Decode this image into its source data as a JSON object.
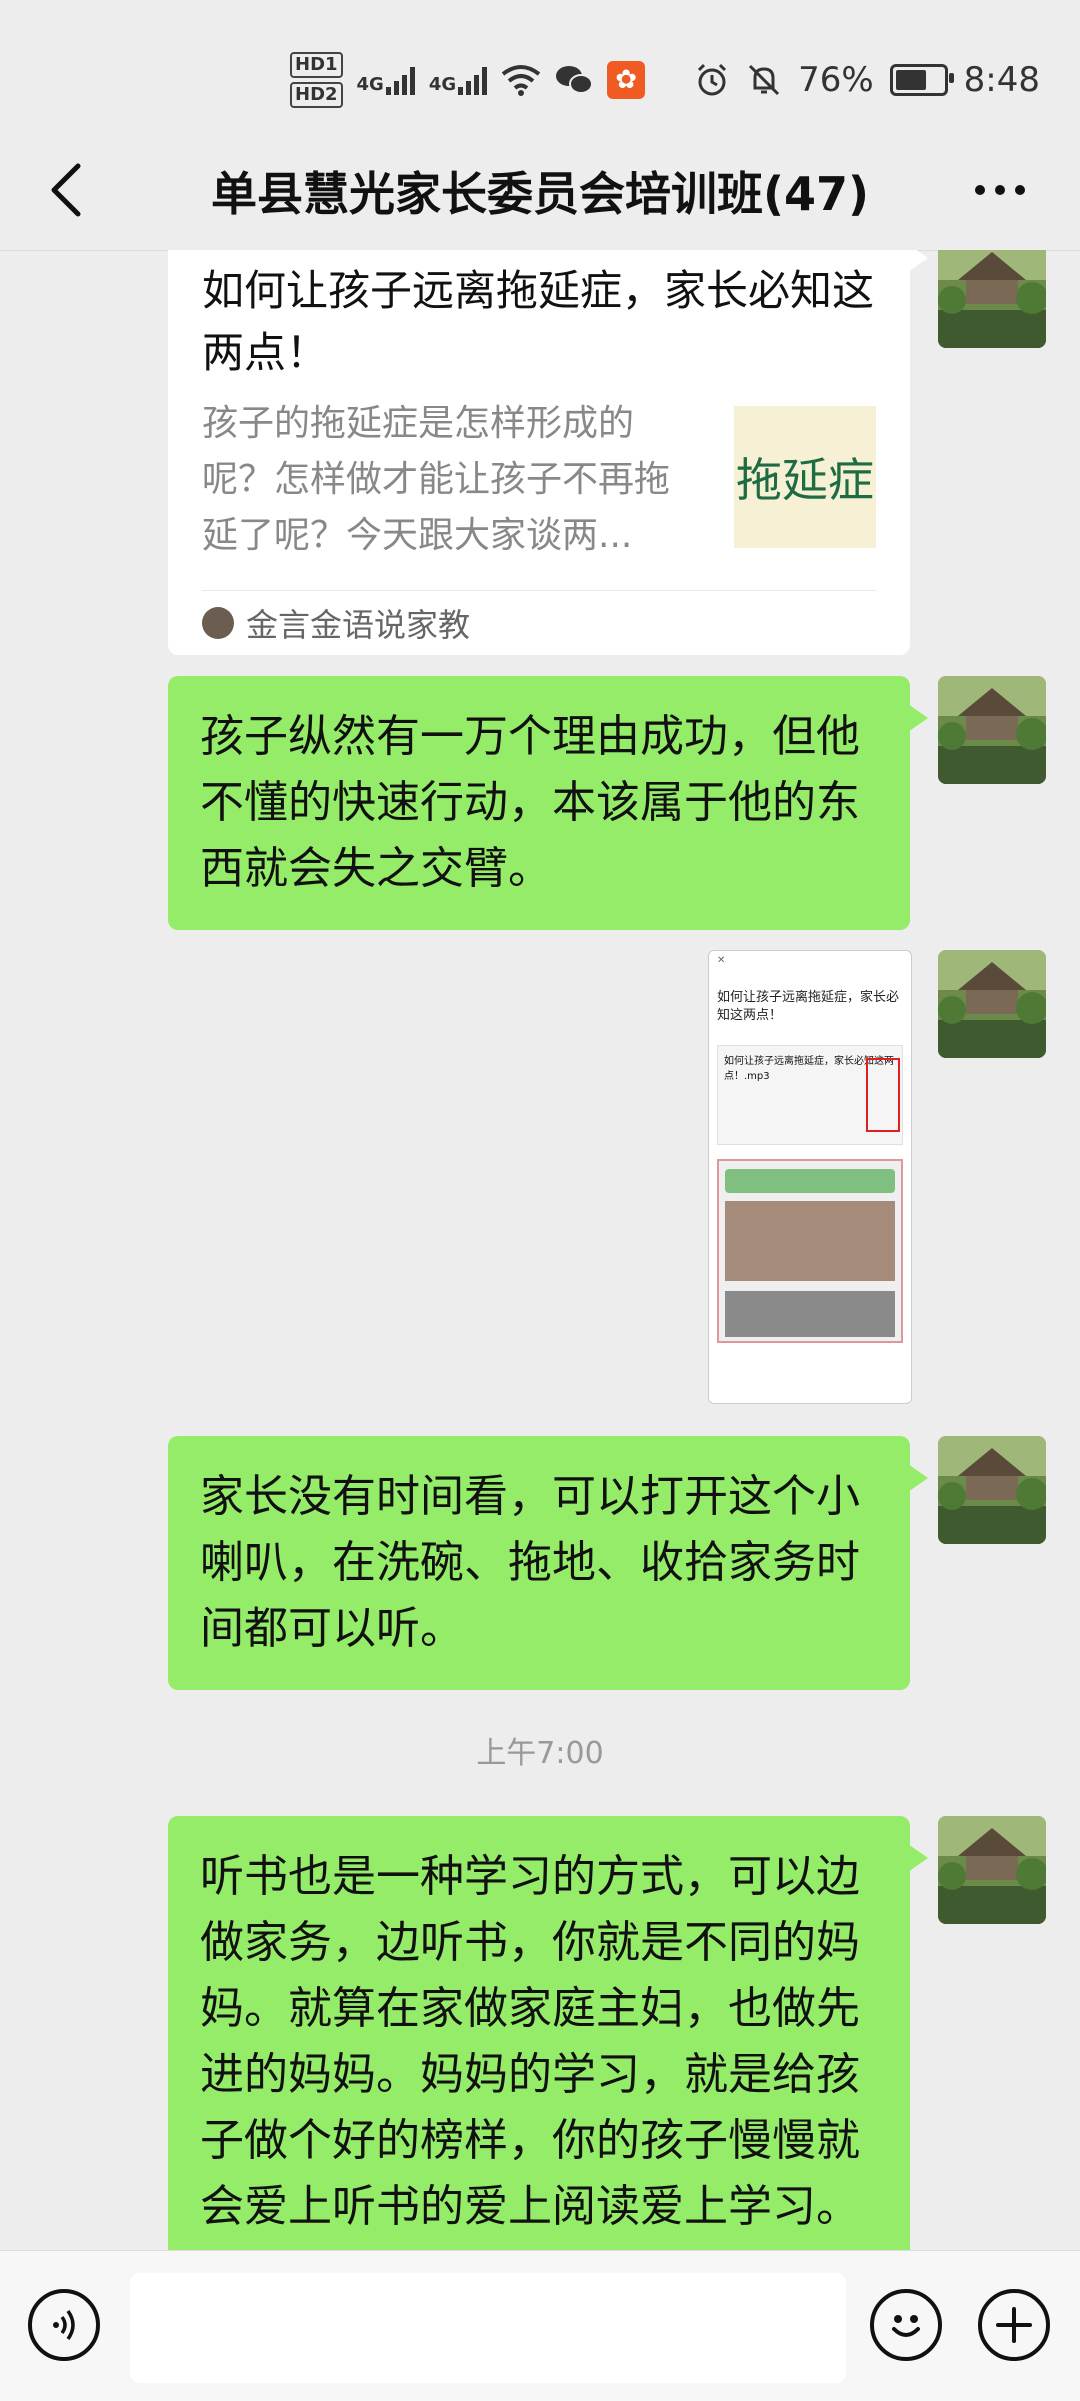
{
  "status_bar": {
    "hd1": "HD1",
    "hd2": "HD2",
    "net1": "4G",
    "net2": "4G",
    "battery_percent": "76%",
    "battery_level": 0.76,
    "time": "8:48",
    "icons": [
      "wifi-icon",
      "wechat-icon",
      "kuaishou-icon",
      "alarm-icon",
      "mute-icon",
      "battery-icon"
    ]
  },
  "header": {
    "title": "单县慧光家长委员会培训班(47)",
    "back_icon": "chevron-left-icon",
    "more_icon": "more-dots-icon"
  },
  "messages": [
    {
      "type": "link_card",
      "title": "如何让孩子远离拖延症，家长必知这两点！",
      "description": "孩子的拖延症是怎样形成的呢？怎样做才能让孩子不再拖延了呢？今天跟大家谈两...",
      "thumb_text": "拖延症",
      "source": "金言金语说家教"
    },
    {
      "type": "text",
      "text": "孩子纵然有一万个理由成功，但他不懂的快速行动，本该属于他的东西就会失之交臂。"
    },
    {
      "type": "image",
      "image_title": "如何让孩子远离拖延症，家长必知这两点！",
      "image_audio": "如何让孩子远离拖延症，家长必知这两点！.mp3"
    },
    {
      "type": "text",
      "text": "家长没有时间看，可以打开这个小喇叭，在洗碗、拖地、收拾家务时间都可以听。"
    },
    {
      "type": "timestamp",
      "text": "上午7:00"
    },
    {
      "type": "text",
      "text": "听书也是一种学习的方式，可以边做家务，边听书，你就是不同的妈妈。就算在家做家庭主妇，也做先进的妈妈。妈妈的学习，就是给孩子做个好的榜样，你的孩子慢慢就会爱上听书的爱上阅读爱上学习。"
    }
  ],
  "input_bar": {
    "voice_icon": "voice-icon",
    "emoji_icon": "emoji-icon",
    "plus_icon": "plus-icon",
    "value": ""
  },
  "colors": {
    "bubble_green": "#95ec69",
    "background": "#ededed",
    "input_bg": "#f7f7f7"
  }
}
